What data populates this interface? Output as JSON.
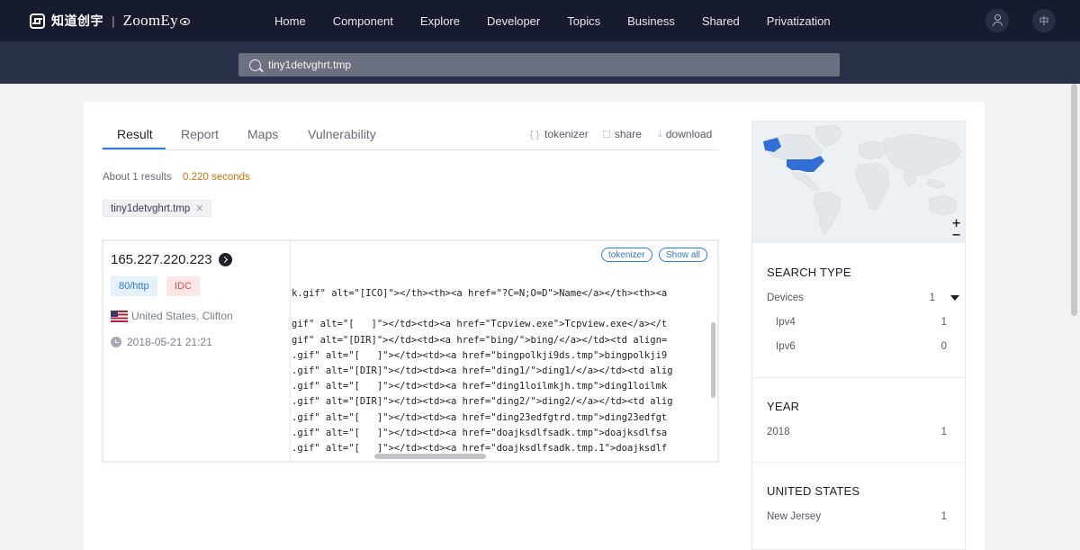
{
  "brand": {
    "cn": "知道创宇",
    "separator": "|",
    "en": "ZoomEy"
  },
  "nav": [
    "Home",
    "Component",
    "Explore",
    "Developer",
    "Topics",
    "Business",
    "Shared",
    "Privatization"
  ],
  "lang_label": "中",
  "search": {
    "value": "tiny1detvghrt.tmp"
  },
  "tabs": [
    "Result",
    "Report",
    "Maps",
    "Vulnerability"
  ],
  "tools": {
    "tokenizer": "tokenizer",
    "share": "share",
    "download": "download"
  },
  "results": {
    "summary": "About 1 results",
    "time": "0.220 seconds"
  },
  "filter_chip": "tiny1detvghrt.tmp",
  "result": {
    "ip": "165.227.220.223",
    "port_badge": "80/http",
    "type_badge": "IDC",
    "location": "United States, Clifton",
    "date": "2018-05-21 21:21",
    "tokenizer_label": "tokenizer",
    "show_all_label": "Show all",
    "code_lines": [
      "k.gif\" alt=\"[ICO]\"></th><th><a href=\"?C=N;O=D\">Name</a></th><th><a",
      "",
      "gif\" alt=\"[   ]\"></td><td><a href=\"Tcpview.exe\">Tcpview.exe</a></t",
      "gif\" alt=\"[DIR]\"></td><td><a href=\"bing/\">bing/</a></td><td align=",
      ".gif\" alt=\"[   ]\"></td><td><a href=\"bingpolkji9ds.tmp\">bingpolkji9",
      ".gif\" alt=\"[DIR]\"></td><td><a href=\"ding1/\">ding1/</a></td><td alig",
      ".gif\" alt=\"[   ]\"></td><td><a href=\"ding1loilmkjh.tmp\">ding1loilmk",
      ".gif\" alt=\"[DIR]\"></td><td><a href=\"ding2/\">ding2/</a></td><td alig",
      ".gif\" alt=\"[   ]\"></td><td><a href=\"ding23edfgtrd.tmp\">ding23edfgt",
      ".gif\" alt=\"[   ]\"></td><td><a href=\"doajksdlfsadk.tmp\">doajksdlfsa",
      ".gif\" alt=\"[   ]\"></td><td><a href=\"doajksdlfsadk.tmp.1\">doajksdlf"
    ]
  },
  "map": {
    "zoom_in": "+",
    "zoom_out": "−",
    "highlight_color": "#2f6fd6"
  },
  "sidebar": {
    "search_type": {
      "title": "SEARCH TYPE",
      "devices": {
        "label": "Devices",
        "count": "1"
      },
      "items": [
        {
          "label": "Ipv4",
          "count": "1"
        },
        {
          "label": "Ipv6",
          "count": "0"
        }
      ]
    },
    "year": {
      "title": "YEAR",
      "items": [
        {
          "label": "2018",
          "count": "1"
        }
      ]
    },
    "country": {
      "title": "UNITED STATES",
      "items": [
        {
          "label": "New Jersey",
          "count": "1"
        }
      ]
    }
  },
  "colors": {
    "nav_bg": "#161c2e",
    "search_bg": "#283148",
    "accent": "#2f7be0",
    "time": "#d4740f"
  }
}
